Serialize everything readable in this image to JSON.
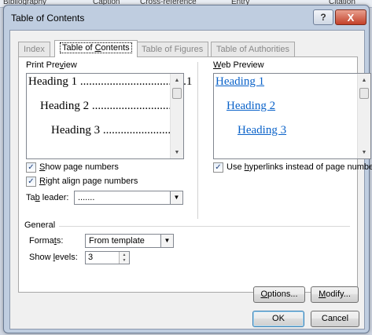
{
  "background_app": {
    "items": [
      "Bibliography",
      "Caption",
      "Cross-reference",
      "Entry",
      "Citation"
    ]
  },
  "dialog": {
    "title": "Table of Contents",
    "help_label": "?",
    "close_label": "X",
    "tabs": [
      {
        "label": "Index",
        "active": false
      },
      {
        "pre": "Table of ",
        "key": "C",
        "post": "ontents",
        "active": true
      },
      {
        "label": "Table of Figures",
        "active": false
      },
      {
        "label": "Table of Authorities",
        "active": false
      }
    ],
    "print_preview": {
      "label_pre": "Print Pre",
      "label_key": "v",
      "label_post": "iew",
      "entries": [
        {
          "text": "Heading 1 ....................................1"
        },
        {
          "text": "Heading 2 .............................3"
        },
        {
          "text": "Heading 3 .......................5"
        }
      ]
    },
    "web_preview": {
      "label_key": "W",
      "label_post": "eb Preview",
      "links": [
        "Heading 1",
        "Heading 2",
        "Heading 3"
      ]
    },
    "show_page_numbers": {
      "checked": true,
      "key": "S",
      "post": "how page numbers"
    },
    "right_align": {
      "checked": true,
      "key": "R",
      "post": "ight align page numbers"
    },
    "tab_leader": {
      "pre": "Ta",
      "key": "b",
      "post": " leader:",
      "value": "......."
    },
    "use_hyperlinks": {
      "checked": true,
      "pre": "Use ",
      "key": "h",
      "post": "yperlinks instead of page numbers"
    },
    "general": {
      "label": "General",
      "formats": {
        "pre": "Forma",
        "key": "t",
        "post": "s:",
        "value": "From template"
      },
      "show_levels": {
        "pre": "Show ",
        "key": "l",
        "post": "evels:",
        "value": "3"
      }
    },
    "buttons": {
      "options": {
        "key": "O",
        "post": "ptions..."
      },
      "modify": {
        "key": "M",
        "post": "odify..."
      },
      "ok": "OK",
      "cancel": "Cancel"
    },
    "colors": {
      "link": "#0a62c9",
      "chrome": "#bfcde0",
      "close": "#c3412a"
    }
  }
}
